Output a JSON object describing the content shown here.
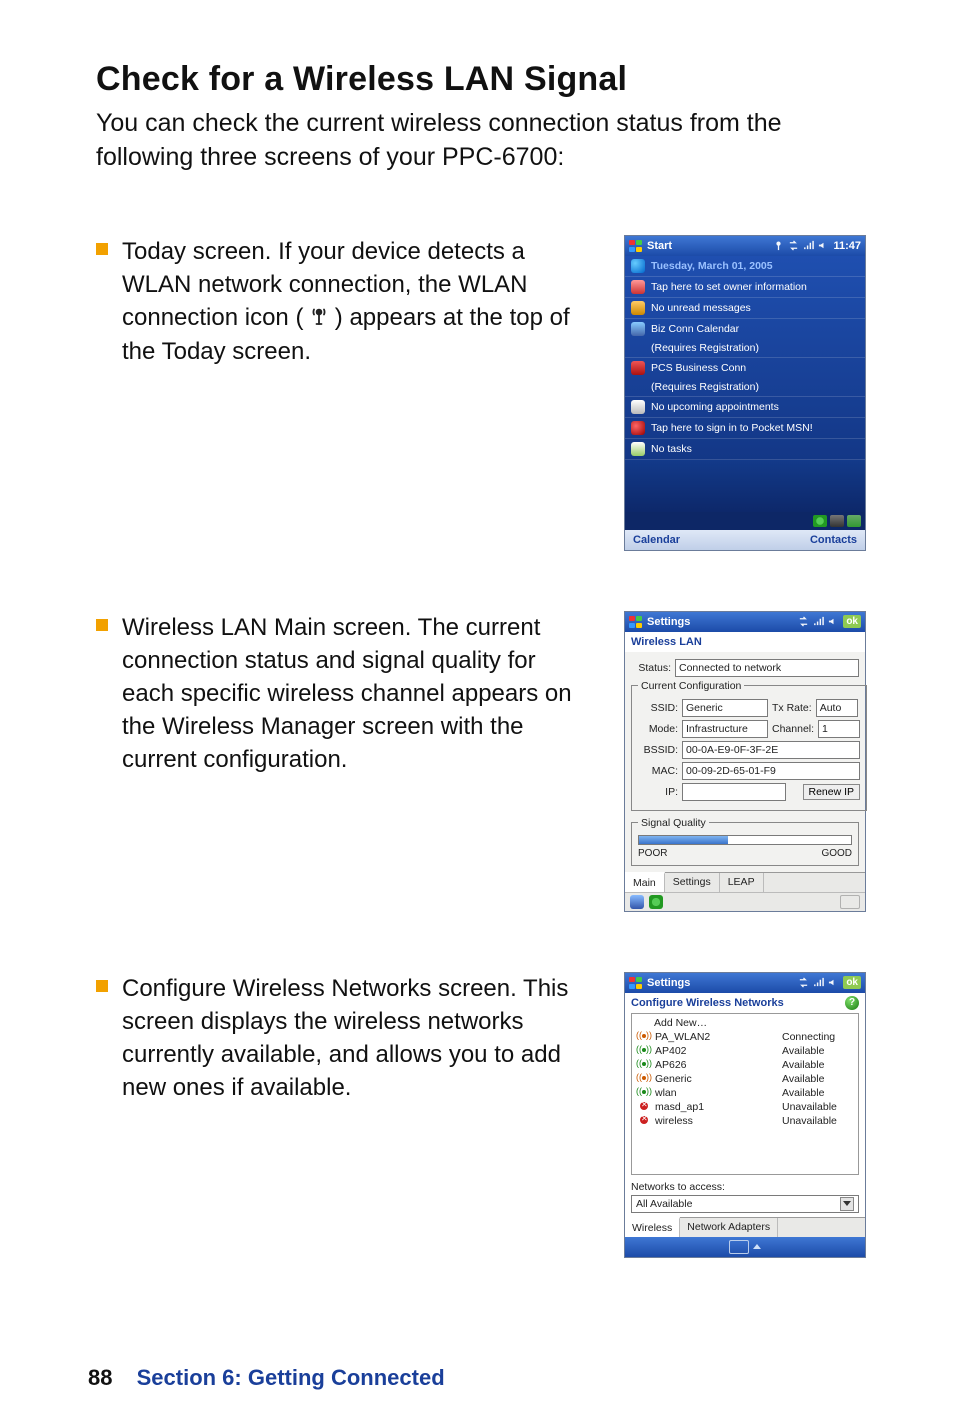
{
  "page": {
    "heading": "Check for a Wireless LAN Signal",
    "intro": "You can check the current wireless connection status from the following three screens of your PPC-6700:",
    "footer_page": "88",
    "footer_section": "Section 6: Getting Connected"
  },
  "bullets": {
    "b1_pre": "Today screen. If your device detects a WLAN network connection, the WLAN connection icon (",
    "b1_post": ") appears at the top of the Today screen.",
    "b2": "Wireless LAN Main screen. The current connection status and signal quality for each specific wireless channel appears on the Wireless Manager screen with the current configuration.",
    "b3": "Configure Wireless Networks screen. This screen displays the wireless networks currently available, and allows you to add new ones if available."
  },
  "shot1": {
    "title": "Start",
    "time": "11:47",
    "date": "Tuesday, March 01, 2005",
    "rows": {
      "owner": "Tap here to set owner information",
      "mail": "No unread messages",
      "biz1": "Biz Conn Calendar",
      "biz1b": "(Requires Registration)",
      "pcs1": "PCS Business Conn",
      "pcs1b": "(Requires Registration)",
      "appt": "No upcoming appointments",
      "msn": "Tap here to sign in to Pocket MSN!",
      "tasks": "No tasks"
    },
    "softkeys": {
      "left": "Calendar",
      "right": "Contacts"
    }
  },
  "shot2": {
    "title": "Settings",
    "ok": "ok",
    "subhead": "Wireless LAN",
    "status_label": "Status:",
    "status": "Connected to network",
    "group1": "Current Configuration",
    "ssid_label": "SSID:",
    "ssid": "Generic",
    "txrate_label": "Tx Rate:",
    "txrate": "Auto",
    "mode_label": "Mode:",
    "mode": "Infrastructure",
    "channel_label": "Channel:",
    "channel": "1",
    "bssid_label": "BSSID:",
    "bssid": "00-0A-E9-0F-3F-2E",
    "mac_label": "MAC:",
    "mac": "00-09-2D-65-01-F9",
    "ip_label": "IP:",
    "ip": "",
    "renew": "Renew IP",
    "group2": "Signal Quality",
    "poor": "POOR",
    "good": "GOOD",
    "tabs": {
      "main": "Main",
      "settings": "Settings",
      "leap": "LEAP"
    }
  },
  "shot3": {
    "title": "Settings",
    "ok": "ok",
    "subhead": "Configure Wireless Networks",
    "addnew": "Add New…",
    "networks": [
      {
        "name": "PA_WLAN2",
        "status": "Connecting",
        "icon": "wave-orange"
      },
      {
        "name": "AP402",
        "status": "Available",
        "icon": "wave"
      },
      {
        "name": "AP626",
        "status": "Available",
        "icon": "wave"
      },
      {
        "name": "Generic",
        "status": "Available",
        "icon": "wave-orange"
      },
      {
        "name": "wlan",
        "status": "Available",
        "icon": "wave"
      },
      {
        "name": "masd_ap1",
        "status": "Unavailable",
        "icon": "x"
      },
      {
        "name": "wireless",
        "status": "Unavailable",
        "icon": "x"
      }
    ],
    "access_label": "Networks to access:",
    "access_value": "All Available",
    "tabs": {
      "wireless": "Wireless",
      "adapters": "Network Adapters"
    }
  }
}
